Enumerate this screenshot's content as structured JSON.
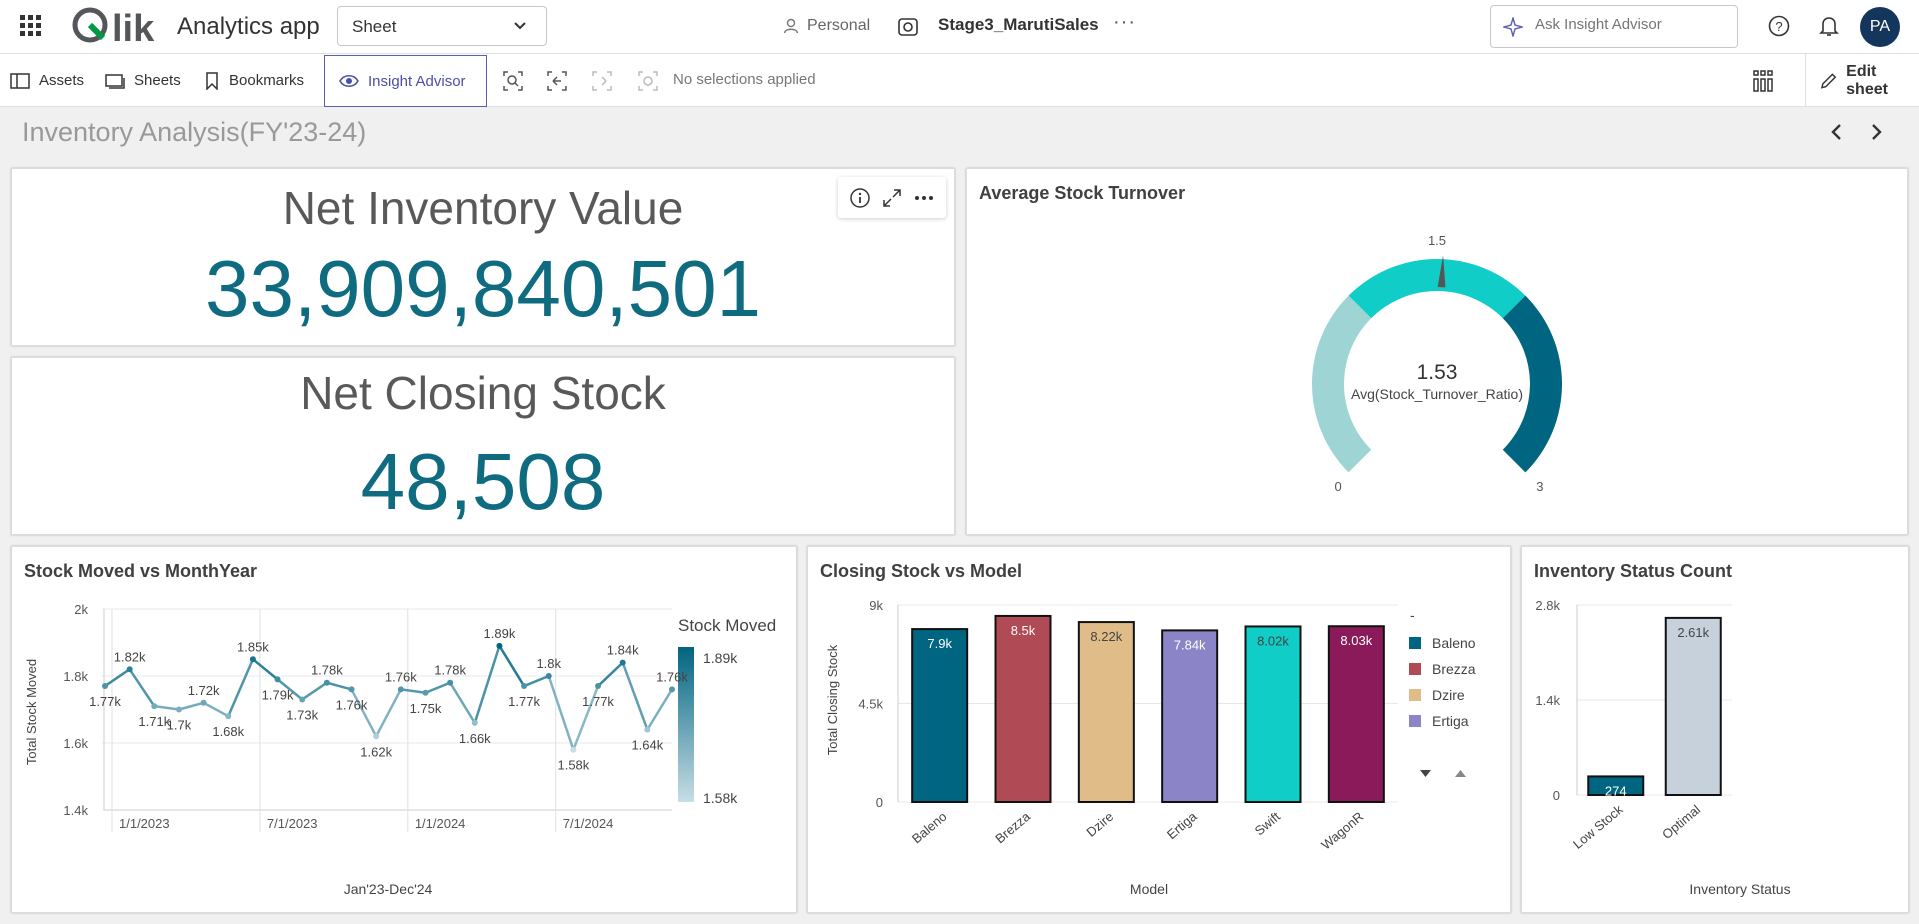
{
  "topbar": {
    "app_title": "Analytics app",
    "sheet_select": "Sheet",
    "space_label": "Personal",
    "app_name": "Stage3_MarutiSales",
    "more": "···",
    "ask_placeholder": "Ask Insight Advisor",
    "avatar_initials": "PA"
  },
  "toolbar": {
    "assets": "Assets",
    "sheets": "Sheets",
    "bookmarks": "Bookmarks",
    "insight_advisor": "Insight Advisor",
    "no_selections": "No selections applied",
    "edit_sheet": "Edit sheet"
  },
  "sheet": {
    "title": "Inventory Analysis(FY'23-24)"
  },
  "kpis": [
    {
      "title": "Net Inventory Value",
      "value": "33,909,840,501"
    },
    {
      "title": "Net Closing Stock",
      "value": "48,508"
    }
  ],
  "colors": {
    "teal": "#006580",
    "accent_purple": "#5a5fb3",
    "kpi_value": "#0f6b80"
  },
  "chart_data": [
    {
      "type": "gauge",
      "title": "Average Stock Turnover",
      "value": 1.53,
      "value_label": "1.53",
      "measure_label": "Avg(Stock_Turnover_Ratio)",
      "min": 0,
      "max": 3,
      "segment_breaks": [
        1,
        2
      ],
      "tick_labels": [
        "0",
        "1.5",
        "3"
      ],
      "segment_colors": [
        "#9ed4d4",
        "#11cdc8",
        "#006580"
      ]
    },
    {
      "type": "line",
      "title": "Stock Moved vs MonthYear",
      "xlabel": "Jan'23-Dec'24",
      "ylabel": "Total Stock Moved",
      "ylim": [
        1400,
        2000
      ],
      "y_ticks": [
        "2k",
        "1.8k",
        "1.6k",
        "1.4k"
      ],
      "x_ticks": [
        "1/1/2023",
        "7/1/2023",
        "1/1/2024",
        "7/1/2024"
      ],
      "legend_title": "Stock Moved",
      "legend_max": "1.89k",
      "legend_min": "1.58k",
      "x": [
        "Jan 2023",
        "Feb 2023",
        "Mar 2023",
        "Apr 2023",
        "May 2023",
        "Jun 2023",
        "Jul 2023",
        "Aug 2023",
        "Sep 2023",
        "Oct 2023",
        "Nov 2023",
        "Dec 2023",
        "Jan 2024",
        "Feb 2024",
        "Mar 2024",
        "Apr 2024",
        "May 2024",
        "Jun 2024",
        "Jul 2024",
        "Aug 2024",
        "Sep 2024",
        "Oct 2024",
        "Nov 2024",
        "Dec 2024"
      ],
      "values": [
        1770,
        1820,
        1710,
        1700,
        1720,
        1680,
        1850,
        1790,
        1730,
        1780,
        1760,
        1620,
        1760,
        1750,
        1780,
        1660,
        1890,
        1770,
        1800,
        1580,
        1770,
        1840,
        1640,
        1760
      ],
      "labels": [
        "1.77k",
        "1.82k",
        "1.71k",
        "1.7k",
        "1.72k",
        "1.68k",
        "1.85k",
        "1.79k",
        "1.73k",
        "1.78k",
        "1.76k",
        "1.62k",
        "1.76k",
        "1.75k",
        "1.78k",
        "1.66k",
        "1.89k",
        "1.77k",
        "1.8k",
        "1.58k",
        "1.77k",
        "1.84k",
        "1.64k",
        "1.76k"
      ]
    },
    {
      "type": "bar",
      "title": "Closing Stock vs Model",
      "xlabel": "Model",
      "ylabel": "Total Closing Stock",
      "ylim": [
        0,
        9000
      ],
      "y_ticks": [
        "9k",
        "4.5k",
        "0"
      ],
      "categories": [
        "Baleno",
        "Brezza",
        "Dzire",
        "Ertiga",
        "Swift",
        "WagonR"
      ],
      "values": [
        7900,
        8500,
        8220,
        7840,
        8020,
        8030
      ],
      "labels": [
        "7.9k",
        "8.5k",
        "8.22k",
        "7.84k",
        "8.02k",
        "8.03k"
      ],
      "colors": [
        "#006580",
        "#b04a55",
        "#e0bd88",
        "#8b85c8",
        "#11cdc8",
        "#8b1a5a"
      ],
      "legend_title": "-",
      "legend": [
        "Baleno",
        "Brezza",
        "Dzire",
        "Ertiga"
      ]
    },
    {
      "type": "bar",
      "title": "Inventory Status Count",
      "xlabel": "Inventory Status",
      "ylim": [
        0,
        2800
      ],
      "y_ticks": [
        "2.8k",
        "1.4k",
        "0"
      ],
      "categories": [
        "Low Stock",
        "Optimal"
      ],
      "values": [
        274,
        2610
      ],
      "labels": [
        "274",
        "2.61k"
      ],
      "colors": [
        "#006580",
        "#c6d1dc"
      ]
    }
  ]
}
